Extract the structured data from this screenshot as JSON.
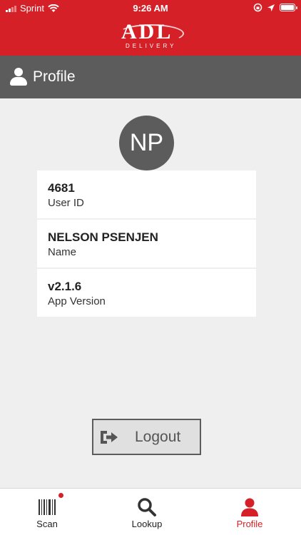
{
  "status_bar": {
    "carrier": "Sprint",
    "time": "9:26 AM"
  },
  "brand": {
    "logo_text": "ADL",
    "logo_sub": "DELIVERY"
  },
  "header": {
    "title": "Profile",
    "icon": "person-icon"
  },
  "profile": {
    "initials": "NP",
    "fields": [
      {
        "value": "4681",
        "label": "User ID"
      },
      {
        "value": "NELSON PSENJEN",
        "label": "Name"
      },
      {
        "value": "v2.1.6",
        "label": "App Version"
      }
    ]
  },
  "logout": {
    "label": "Logout",
    "icon": "sign-out-icon"
  },
  "tabs": [
    {
      "label": "Scan",
      "icon": "barcode-icon",
      "has_badge": true
    },
    {
      "label": "Lookup",
      "icon": "search-icon"
    },
    {
      "label": "Profile",
      "icon": "person-icon",
      "active": true
    }
  ],
  "colors": {
    "brand_red": "#d62027",
    "header_gray": "#5c5c5c",
    "background": "#efefef"
  }
}
